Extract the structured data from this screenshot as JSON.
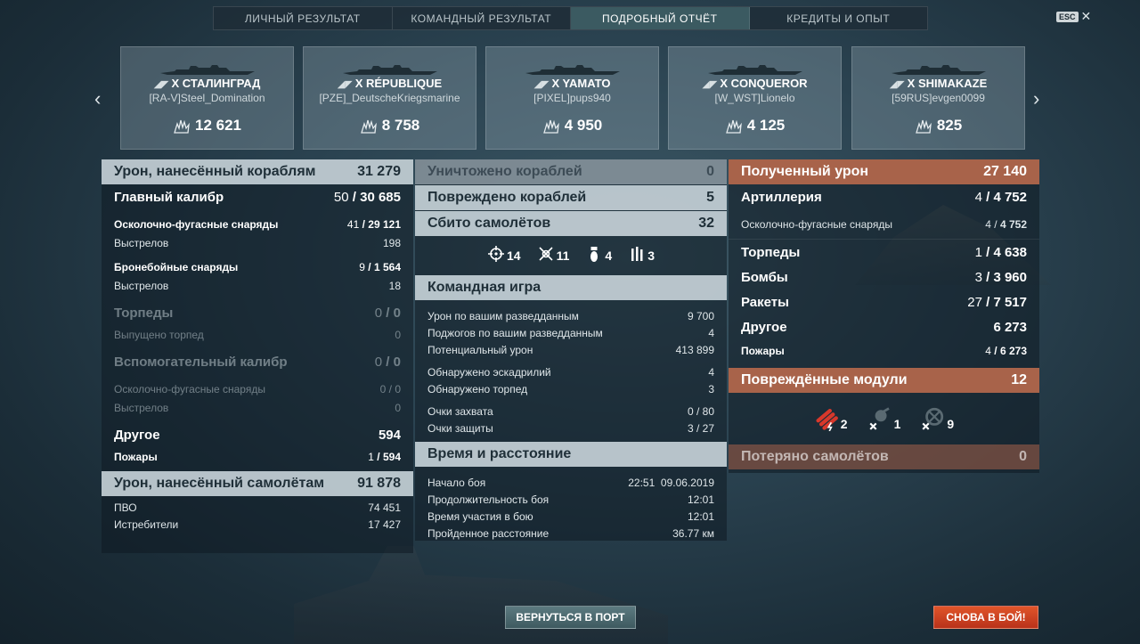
{
  "tabs": [
    "ЛИЧНЫЙ РЕЗУЛЬТАТ",
    "КОМАНДНЫЙ РЕЗУЛЬТАТ",
    "ПОДРОБНЫЙ ОТЧЁТ",
    "КРЕДИТЫ И ОПЫТ"
  ],
  "active_tab": "ПОДРОБНЫЙ ОТЧЁТ",
  "esc_label": "ESC",
  "ships": [
    {
      "tier": "X",
      "name": "СТАЛИНГРАД",
      "player": "[RA-V]Steel_Domination",
      "damage": "12 621"
    },
    {
      "tier": "X",
      "name": "RÉPUBLIQUE",
      "player": "[PZE]_DeutscheKriegsmarine",
      "damage": "8 758"
    },
    {
      "tier": "X",
      "name": "YAMATO",
      "player": "[PIXEL]pups940",
      "damage": "4 950"
    },
    {
      "tier": "X",
      "name": "CONQUEROR",
      "player": "[W_WST]Lionelo",
      "damage": "4 125"
    },
    {
      "tier": "X",
      "name": "SHIMAKAZE",
      "player": "[59RUS]evgen0099",
      "damage": "825"
    }
  ],
  "left": {
    "ships_damage": {
      "label": "Урон, нанесённый кораблям",
      "value": "31 279"
    },
    "main_battery": {
      "label": "Главный калибр",
      "hits": "50",
      "dmg": "30 685"
    },
    "he_shells": {
      "label": "Осколочно-фугасные снаряды",
      "hits": "41",
      "dmg": "29 121"
    },
    "he_shots": {
      "label": "Выстрелов",
      "value": "198"
    },
    "ap_shells": {
      "label": "Бронебойные снаряды",
      "hits": "9",
      "dmg": "1 564"
    },
    "ap_shots": {
      "label": "Выстрелов",
      "value": "18"
    },
    "torpedoes": {
      "label": "Торпеды",
      "hits": "0",
      "dmg": "0"
    },
    "torps_launched": {
      "label": "Выпущено торпед",
      "value": "0"
    },
    "secondary": {
      "label": "Вспомогательный калибр",
      "hits": "0",
      "dmg": "0"
    },
    "sec_he": {
      "label": "Осколочно-фугасные снаряды",
      "hits": "0",
      "dmg": "0"
    },
    "sec_shots": {
      "label": "Выстрелов",
      "value": "0"
    },
    "other": {
      "label": "Другое",
      "value": "594"
    },
    "fires": {
      "label": "Пожары",
      "hits": "1",
      "dmg": "594"
    },
    "plane_damage": {
      "label": "Урон, нанесённый самолётам",
      "value": "91 878"
    },
    "aa": {
      "label": "ПВО",
      "value": "74 451"
    },
    "fighters": {
      "label": "Истребители",
      "value": "17 427"
    }
  },
  "middle": {
    "destroyed": {
      "label": "Уничтожено кораблей",
      "value": "0"
    },
    "damaged": {
      "label": "Повреждено кораблей",
      "value": "5"
    },
    "planes_down": {
      "label": "Сбито самолётов",
      "value": "32"
    },
    "plane_icons": [
      {
        "icon": "crosshair-icon",
        "value": "14"
      },
      {
        "icon": "fighter-icon",
        "value": "11"
      },
      {
        "icon": "bomb-icon",
        "value": "4"
      },
      {
        "icon": "torpedo-icon",
        "value": "3"
      }
    ],
    "teamplay": {
      "title": "Командная игра",
      "rows": [
        {
          "label": "Урон по вашим разведданным",
          "value": "9 700"
        },
        {
          "label": "Поджогов по вашим разведданным",
          "value": "4"
        },
        {
          "label": "Потенциальный урон",
          "value": "413 899"
        },
        {
          "label": "Обнаружено эскадрилий",
          "value": "4"
        },
        {
          "label": "Обнаружено торпед",
          "value": "3"
        },
        {
          "label": "Очки захвата",
          "value": "0 / 80"
        },
        {
          "label": "Очки защиты",
          "value": "3 / 27"
        }
      ]
    },
    "time": {
      "title": "Время и расстояние",
      "rows": [
        {
          "label": "Начало боя",
          "value": "22:51  09.06.2019"
        },
        {
          "label": "Продолжительность боя",
          "value": "12:01"
        },
        {
          "label": "Время участия в бою",
          "value": "12:01"
        },
        {
          "label": "Пройденное расстояние",
          "value": "36.77 км"
        }
      ]
    }
  },
  "right": {
    "received": {
      "label": "Полученный урон",
      "value": "27 140"
    },
    "artillery": {
      "label": "Артиллерия",
      "hits": "4",
      "dmg": "4 752"
    },
    "he": {
      "label": "Осколочно-фугасные снаряды",
      "hits": "4",
      "dmg": "4 752"
    },
    "torpedoes": {
      "label": "Торпеды",
      "hits": "1",
      "dmg": "4 638"
    },
    "bombs": {
      "label": "Бомбы",
      "hits": "3",
      "dmg": "3 960"
    },
    "rockets": {
      "label": "Ракеты",
      "hits": "27",
      "dmg": "7 517"
    },
    "other": {
      "label": "Другое",
      "value": "6 273"
    },
    "fires": {
      "label": "Пожары",
      "hits": "4",
      "dmg": "6 273"
    },
    "modules": {
      "label": "Повреждённые модули",
      "value": "12"
    },
    "module_icons": [
      {
        "icon": "torpedo-tubes-icon",
        "value": "2"
      },
      {
        "icon": "turret-destroyed-icon",
        "value": "1"
      },
      {
        "icon": "aa-mount-destroyed-icon",
        "value": "9"
      }
    ],
    "planes_lost": {
      "label": "Потеряно самолётов",
      "value": "0"
    }
  },
  "buttons": {
    "port": "ВЕРНУТЬСЯ В ПОРТ",
    "battle": "СНОВА В БОЙ!"
  }
}
